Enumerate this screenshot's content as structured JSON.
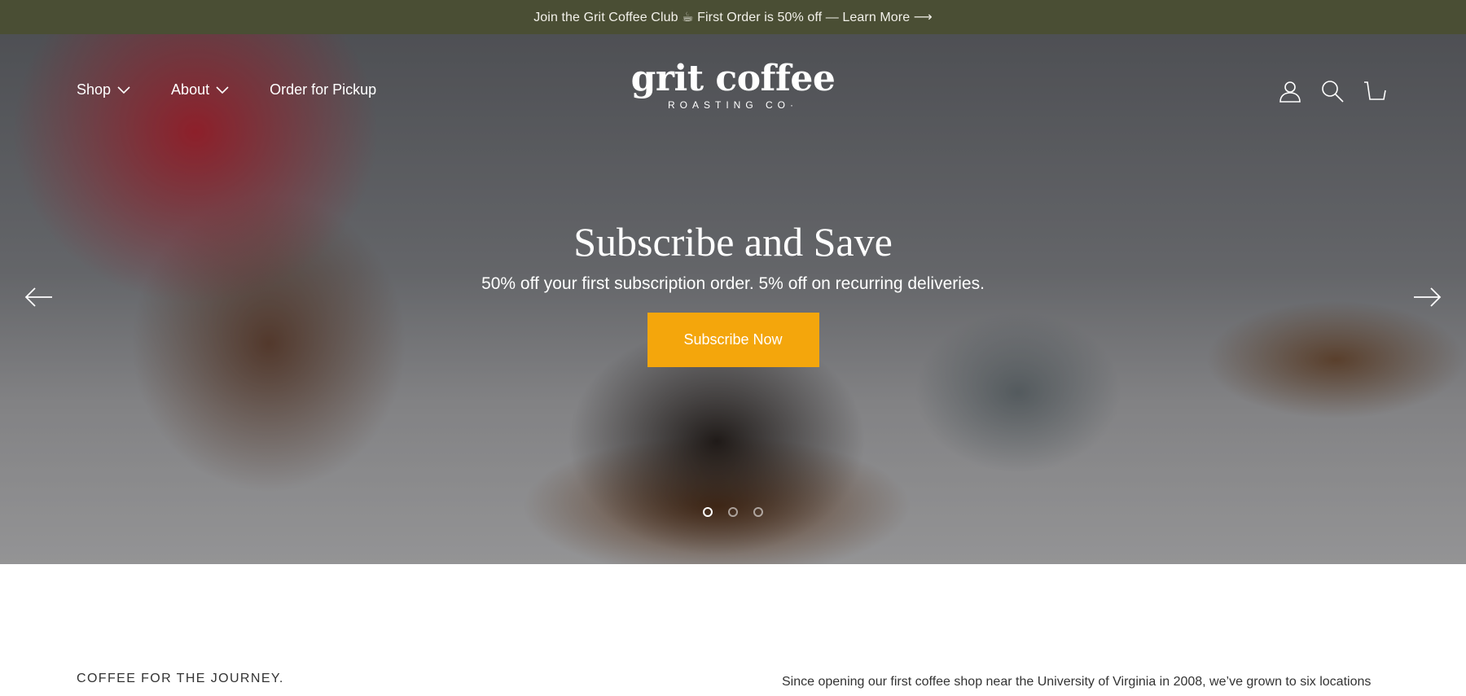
{
  "announcement": {
    "text": "Join the Grit Coffee Club ☕ First Order is 50% off — Learn More ⟶"
  },
  "header": {
    "nav": [
      {
        "label": "Shop",
        "has_dropdown": true
      },
      {
        "label": "About",
        "has_dropdown": true
      },
      {
        "label": "Order for Pickup",
        "has_dropdown": false
      }
    ],
    "logo": {
      "main": "grit coffee",
      "sub": "ROASTING CO·"
    },
    "icons": [
      "account-icon",
      "search-icon",
      "cart-icon"
    ]
  },
  "hero": {
    "title": "Subscribe and Save",
    "subtitle": "50% off your first subscription order. 5% off on recurring deliveries.",
    "button_label": "Subscribe Now",
    "button_color": "#f4a60c",
    "slide_count": 3,
    "active_slide": 1
  },
  "intro": {
    "eyebrow": "COFFEE FOR THE JOURNEY.",
    "body": "Since opening our first coffee shop near the University of Virginia in 2008, we’ve grown to six locations in"
  },
  "colors": {
    "announcement_bg": "#4a4e34",
    "accent": "#f4a60c"
  }
}
